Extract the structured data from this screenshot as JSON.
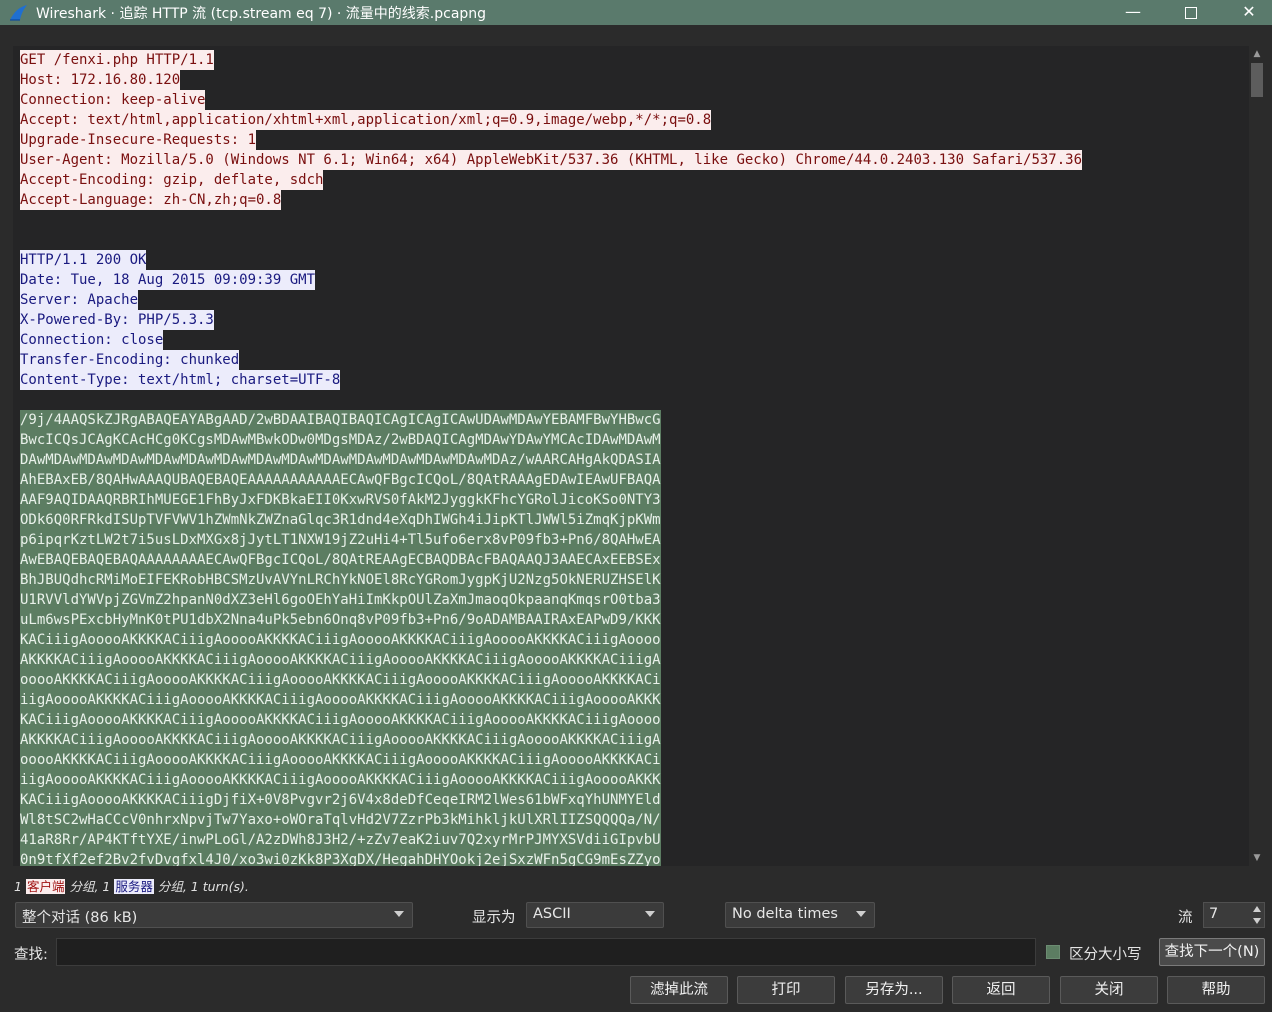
{
  "window": {
    "title": "Wireshark · 追踪 HTTP 流 (tcp.stream eq 7) · 流量中的线索.pcapng",
    "controls": {
      "minimize": "—",
      "close": "✕"
    }
  },
  "stream": {
    "client_lines": [
      "GET /fenxi.php HTTP/1.1",
      "Host: 172.16.80.120",
      "Connection: keep-alive",
      "Accept: text/html,application/xhtml+xml,application/xml;q=0.9,image/webp,*/*;q=0.8",
      "Upgrade-Insecure-Requests: 1",
      "User-Agent: Mozilla/5.0 (Windows NT 6.1; Win64; x64) AppleWebKit/537.36 (KHTML, like Gecko) Chrome/44.0.2403.130 Safari/537.36",
      "Accept-Encoding: gzip, deflate, sdch",
      "Accept-Language: zh-CN,zh;q=0.8"
    ],
    "server_header_lines": [
      "HTTP/1.1 200 OK",
      "Date: Tue, 18 Aug 2015 09:09:39 GMT",
      "Server: Apache",
      "X-Powered-By: PHP/5.3.3",
      "Connection: close",
      "Transfer-Encoding: chunked",
      "Content-Type: text/html; charset=UTF-8"
    ],
    "server_body_lines": [
      "/9j/4AAQSkZJRgABAQEAYABgAAD/2wBDAAIBAQIBAQICAgICAgICAwUDAwMDAwYEBAMFBwYHBwcG",
      "BwcICQsJCAgKCAcHCg0KCgsMDAwMBwkODw0MDgsMDAz/2wBDAQICAgMDAwYDAwYMCAcIDAwMDAwM",
      "DAwMDAwMDAwMDAwMDAwMDAwMDAwMDAwMDAwMDAwMDAwMDAwMDAwMDAwMDAz/wAARCAHgAkQDASIA",
      "AhEBAxEB/8QAHwAAAQUBAQEBAQEAAAAAAAAAAAECAwQFBgcICQoL/8QAtRAAAgEDAwIEAwUFBAQA",
      "AAF9AQIDAAQRBRIhMUEGE1FhByJxFDKBkaEII0KxwRVS0fAkM2JyggkKFhcYGRolJicoKSo0NTY3",
      "ODk6Q0RFRkdISUpTVFVWV1hZWmNkZWZnaGlqc3R1dnd4eXqDhIWGh4iJipKTlJWWl5iZmqKjpKWm",
      "p6ipqrKztLW2t7i5usLDxMXGx8jJytLT1NXW19jZ2uHi4+Tl5ufo6erx8vP09fb3+Pn6/8QAHwEA",
      "AwEBAQEBAQEBAQAAAAAAAAECAwQFBgcICQoL/8QAtREAAgECBAQDBAcFBAQAAQJ3AAECAxEEBSEx",
      "BhJBUQdhcRMiMoEIFEKRobHBCSMzUvAVYnLRChYkNOEl8RcYGRomJygpKjU2Nzg5OkNERUZHSElK",
      "U1RVVldYWVpjZGVmZ2hpanN0dXZ3eHl6goOEhYaHiImKkpOUlZaXmJmaoqOkpaanqKmqsrO0tba3",
      "uLm6wsPExcbHyMnK0tPU1dbX2Nna4uPk5ebn6Onq8vP09fb3+Pn6/9oADAMBAAIRAxEAPwD9/KKK",
      "KACiiigAooooAKKKKACiiigAooooAKKKKACiiigAooooAKKKKACiiigAooooAKKKKACiiigAoooo",
      "AKKKKACiiigAooooAKKKKACiiigAooooAKKKKACiiigAooooAKKKKACiiigAooooAKKKKACiiigA",
      "ooooAKKKKACiiigAooooAKKKKACiiigAooooAKKKKACiiigAooooAKKKKACiiigAooooAKKKKACi",
      "iigAooooAKKKKACiiigAooooAKKKKACiiigAooooAKKKKACiiigAooooAKKKKACiiigAooooAKKK",
      "KACiiigAooooAKKKKACiiigAooooAKKKKACiiigAooooAKKKKACiiigAooooAKKKKACiiigAoooo",
      "AKKKKACiiigAooooAKKKKACiiigAooooAKKKKACiiigAooooAKKKKACiiigAooooAKKKKACiiigA",
      "ooooAKKKKACiiigAooooAKKKKACiiigAooooAKKKKACiiigAooooAKKKKACiiigAooooAKKKKACi",
      "iigAooooAKKKKACiiigAooooAKKKKACiiigAooooAKKKKACiiigAooooAKKKKACiiigAooooAKKK",
      "KACiiigAooooAKKKKACiiigDjfiX+0V8Pvgvr2j6V4x8deDfCeqeIRM2lWes61bWFxqYhUNMYEld",
      "Wl8tSC2wHaCCcV0nhrxNpvjTw7Yaxo+oWOraTqlvHd2V7ZzrPb3kMihkljkUlXRlIIZSQQQQa/N/",
      "41aR8Rr/AP4KTftYXE/inwPLoGl/A2zDWh8J3H2/+zZv7eaK2iuv7Q2xyrMrPJMYXSVdiiGIpvbU",
      "0n9tfXf2ef2Bv2fvDvgfxl4J0/xo3wi0zKk8P3XgDX/HegahDHYOokj2ejSxzWFn5gCG9mEsZZyo"
    ]
  },
  "summary": {
    "part1": "1",
    "client_label": "客户端",
    "part2": "分组, 1",
    "server_label": "服务器",
    "part3": "分组, 1 turn(s)."
  },
  "controls": {
    "conversation_select": "整个对话 (86 kB)",
    "display_as_label": "显示为",
    "display_as_value": "ASCII",
    "delta_select": "No delta times",
    "stream_label": "流",
    "stream_value": "7",
    "find_label": "查找:",
    "find_value": "",
    "case_sensitive_label": "区分大小写",
    "find_next_label": "查找下一个(N)"
  },
  "buttons": {
    "filter_out": "滤掉此流",
    "print": "打印",
    "save_as": "另存为...",
    "back": "返回",
    "close": "关闭",
    "help": "帮助"
  },
  "colors": {
    "client_bg": "#fbeded",
    "client_fg": "#7a0f0f",
    "server_bg": "#ececfb",
    "server_fg": "#1a1a80",
    "body_bg": "#5c7d62",
    "titlebar_bg": "#5a7a6c"
  }
}
